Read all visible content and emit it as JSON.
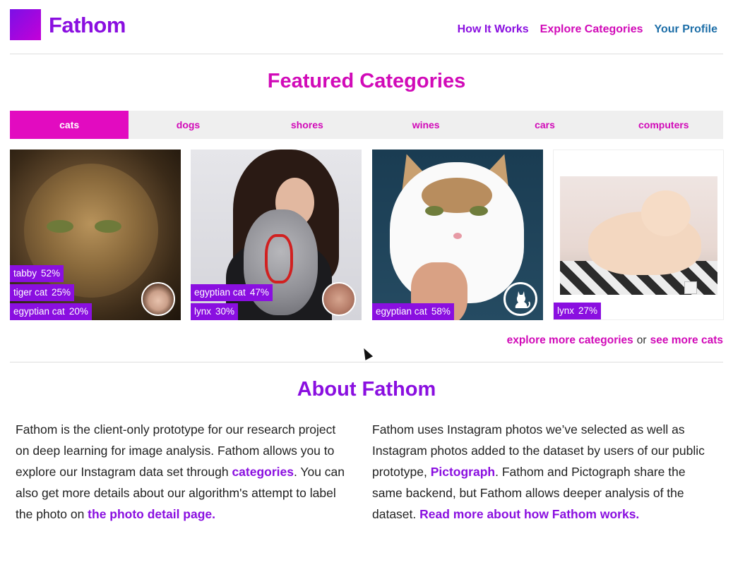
{
  "header": {
    "logo_text": "Fathom",
    "nav": [
      "How It Works",
      "Explore Categories",
      "Your Profile"
    ]
  },
  "featured": {
    "title": "Featured Categories",
    "tabs": [
      "cats",
      "dogs",
      "shores",
      "wines",
      "cars",
      "computers"
    ],
    "active_tab": "cats"
  },
  "photos": [
    {
      "tags": [
        {
          "label": "tabby",
          "pct": "52%"
        },
        {
          "label": "tiger cat",
          "pct": "25%"
        },
        {
          "label": "egyptian cat",
          "pct": "20%"
        }
      ]
    },
    {
      "tags": [
        {
          "label": "egyptian cat",
          "pct": "47%"
        },
        {
          "label": "lynx",
          "pct": "30%"
        }
      ]
    },
    {
      "tags": [
        {
          "label": "egyptian cat",
          "pct": "58%"
        }
      ]
    },
    {
      "tags": [
        {
          "label": "lynx",
          "pct": "27%"
        }
      ]
    }
  ],
  "explore": {
    "more_categories": "explore more categories",
    "or": "or",
    "see_more": "see more cats"
  },
  "about": {
    "title": "About Fathom",
    "left": {
      "t1": "Fathom is the client-only prototype for our research project on deep learning for image analysis. Fathom allows you to explore our Instagram data set through ",
      "link1": "categories",
      "t2": ". You can also get more details about our algorithm's attempt to label the photo on ",
      "link2": "the photo detail page."
    },
    "right": {
      "t1": "Fathom uses Instagram photos we’ve selected as well as Instagram photos added to the dataset by users of our public prototype, ",
      "link1": "Pictograph",
      "t2": ". Fathom and Pictograph share the same backend, but Fathom allows deeper analysis of the dataset. ",
      "link2": "Read more about how Fathom works."
    }
  },
  "colors": {
    "purple": "#8a0fe0",
    "magenta": "#d10ab8",
    "active_tab": "#e20bc0",
    "profile_link": "#1e6fa8"
  }
}
